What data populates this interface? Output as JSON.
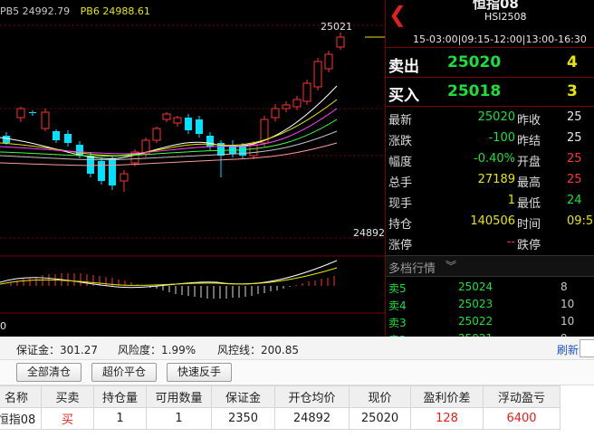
{
  "chart": {
    "ma_legend": [
      {
        "label": "PB5 24992.79",
        "color": "#c8c8c8"
      },
      {
        "label": "PB6 24988.61",
        "color": "#e6e600"
      }
    ],
    "peak_label": "25021",
    "low_label": "24892",
    "zero_label": "0",
    "colors": {
      "up": "#ff3333",
      "down": "#00e0ff",
      "grid": "#7a0000"
    }
  },
  "quote": {
    "name": "恒指08",
    "code": "HSI2508",
    "sessions": "15-03:00|09:15-12:00|13:00-16:30",
    "sell": {
      "label": "卖出",
      "price": "25020",
      "volume": "4"
    },
    "buy": {
      "label": "买入",
      "price": "25018",
      "volume": "3"
    },
    "rows": [
      {
        "l1": "最新",
        "v1": "25020",
        "c1": "green",
        "l2": "昨收",
        "v2": "25",
        "c2": "white"
      },
      {
        "l1": "涨跌",
        "v1": "-100",
        "c1": "green",
        "l2": "昨结",
        "v2": "25",
        "c2": "white"
      },
      {
        "l1": "幅度",
        "v1": "-0.40%",
        "c1": "green",
        "l2": "开盘",
        "v2": "25",
        "c2": "red"
      },
      {
        "l1": "总手",
        "v1": "27189",
        "c1": "yellow",
        "l2": "最高",
        "v2": "25",
        "c2": "red"
      },
      {
        "l1": "现手",
        "v1": "1",
        "c1": "yellow",
        "l2": "最低",
        "v2": "24",
        "c2": "green"
      },
      {
        "l1": "持仓",
        "v1": "140506",
        "c1": "yellow",
        "l2": "时间",
        "v2": "09:5",
        "c2": "yellow"
      },
      {
        "l1": "涨停",
        "v1": "--",
        "c1": "red",
        "l2": "跌停",
        "v2": "",
        "c2": "white"
      }
    ],
    "depth_title": "多档行情",
    "depth_icon": "double-chevron-down-icon",
    "depth": [
      {
        "label": "卖5",
        "price": "25024",
        "volume": "8"
      },
      {
        "label": "卖4",
        "price": "25023",
        "volume": "10"
      },
      {
        "label": "卖3",
        "price": "25022",
        "volume": "10"
      },
      {
        "label": "卖2",
        "price": "25021",
        "volume": "9"
      }
    ]
  },
  "account": {
    "margin": "保证金：301.27",
    "risk": "风险度：1.99%",
    "risk_line": "风控线：200.85",
    "refresh": "刷新"
  },
  "buttons": {
    "close_all": "全部清仓",
    "over_price": "超价平仓",
    "reverse": "快速反手"
  },
  "positions": {
    "headers": [
      "名称",
      "买卖",
      "持仓量",
      "可用数量",
      "保证金",
      "开仓均价",
      "现价",
      "盈利价差",
      "浮动盈亏"
    ],
    "rows": [
      {
        "name": "恒指08",
        "side": "买",
        "qty": "1",
        "avail": "1",
        "margin": "2350",
        "avg": "24892",
        "price": "25020",
        "diff": "128",
        "pnl": "6400"
      }
    ]
  }
}
